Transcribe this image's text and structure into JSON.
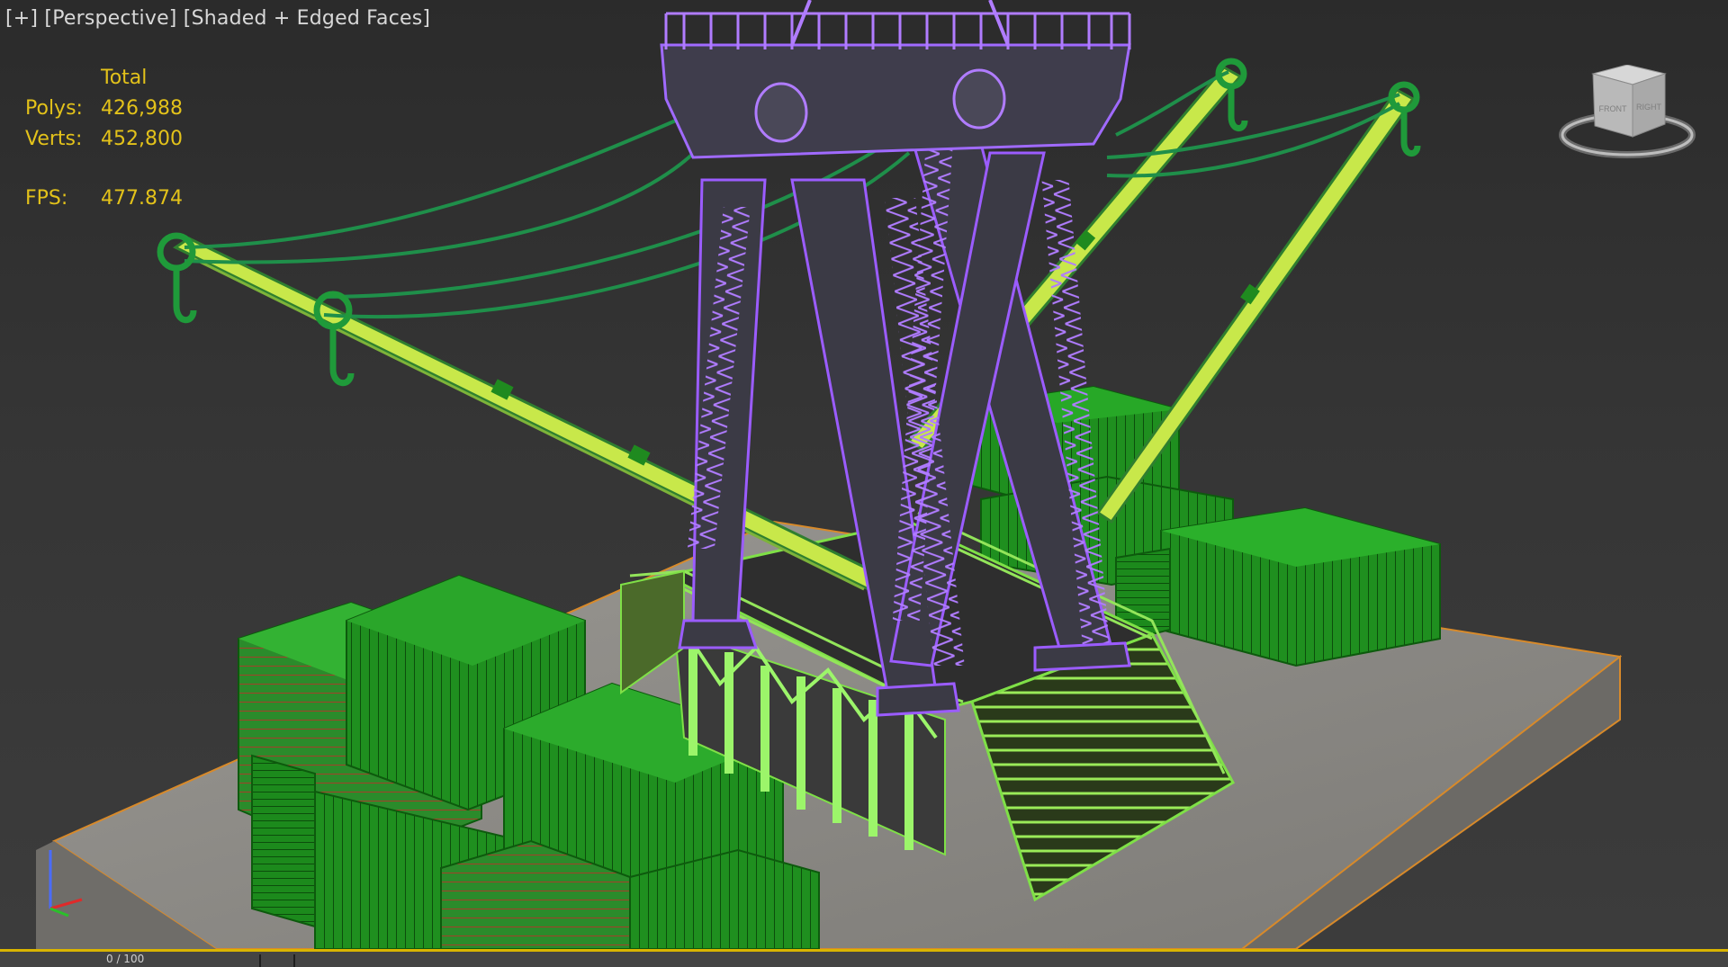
{
  "viewport": {
    "label_plus": "[+]",
    "label_view": "[Perspective]",
    "label_shading": "[Shaded + Edged Faces]"
  },
  "stats": {
    "header": "Total",
    "polys_label": "Polys:",
    "polys_value": "426,988",
    "verts_label": "Verts:",
    "verts_value": "452,800",
    "fps_label": "FPS:",
    "fps_value": "477.874"
  },
  "viewcube": {
    "face_front": "FRONT",
    "face_right": "RIGHT"
  },
  "timeline": {
    "frame_text": "0 / 100"
  },
  "colors": {
    "stats_text": "#e3c21a",
    "tower_wire": "#9b5cff",
    "container_green": "#1f9a1f",
    "boom_yellow": "#c8e84a",
    "platform_lime": "#8ef25a",
    "ground": "#8c8a86",
    "selection_edge": "#d88a2a"
  }
}
